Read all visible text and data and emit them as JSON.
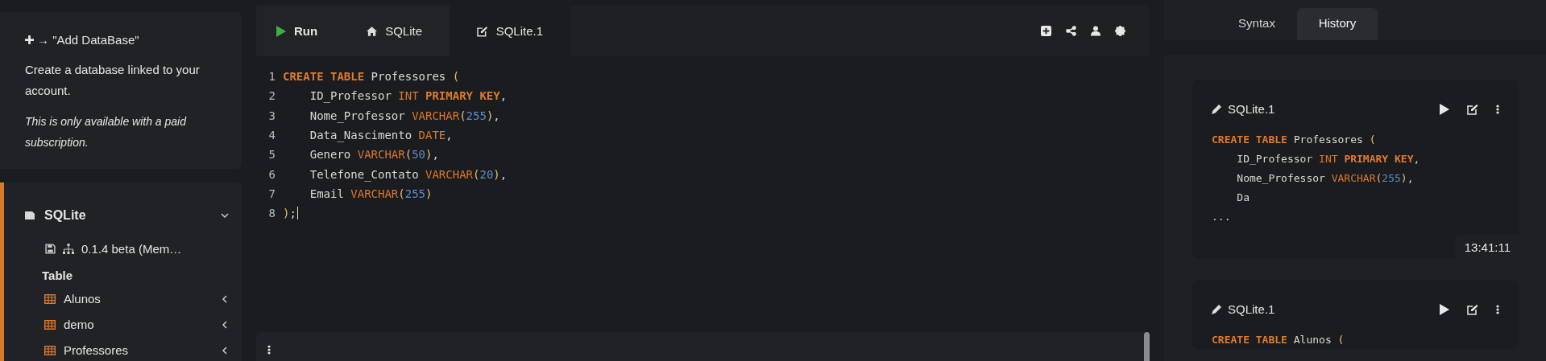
{
  "sidebar": {
    "add_card": {
      "title": "→ \"Add DataBase\"",
      "description": "Create a database linked to your account.",
      "note": "This is only available with a paid subscription."
    },
    "database": {
      "name": "SQLite",
      "expanded": true,
      "version": "0.1.4 beta (Mem…",
      "section": "Table",
      "tables": [
        {
          "name": "Alunos",
          "expanded": false
        },
        {
          "name": "demo",
          "expanded": false
        },
        {
          "name": "Professores",
          "expanded": false
        }
      ]
    }
  },
  "editor": {
    "tabs": [
      {
        "kind": "run",
        "label": "Run",
        "selected": false
      },
      {
        "kind": "home",
        "label": "SQLite",
        "selected": false
      },
      {
        "kind": "edit",
        "label": "SQLite.1",
        "selected": true
      }
    ],
    "lines": [
      {
        "number": "1",
        "cursor": false,
        "tokens": [
          {
            "kind": "keyword",
            "text": "CREATE TABLE"
          },
          {
            "kind": "plain",
            "text": " Professores "
          },
          {
            "kind": "paren",
            "text": "("
          }
        ]
      },
      {
        "number": "2",
        "cursor": false,
        "tokens": [
          {
            "kind": "plain",
            "text": "    ID_Professor "
          },
          {
            "kind": "type",
            "text": "INT "
          },
          {
            "kind": "keyword",
            "text": "PRIMARY KEY"
          },
          {
            "kind": "plain",
            "text": ","
          }
        ]
      },
      {
        "number": "3",
        "cursor": false,
        "tokens": [
          {
            "kind": "plain",
            "text": "    Nome_Professor "
          },
          {
            "kind": "type",
            "text": "VARCHAR"
          },
          {
            "kind": "paren",
            "text": "("
          },
          {
            "kind": "number",
            "text": "255"
          },
          {
            "kind": "paren",
            "text": ")"
          },
          {
            "kind": "plain",
            "text": ","
          }
        ]
      },
      {
        "number": "4",
        "cursor": false,
        "tokens": [
          {
            "kind": "plain",
            "text": "    Data_Nascimento "
          },
          {
            "kind": "type",
            "text": "DATE"
          },
          {
            "kind": "plain",
            "text": ","
          }
        ]
      },
      {
        "number": "5",
        "cursor": false,
        "tokens": [
          {
            "kind": "plain",
            "text": "    Genero "
          },
          {
            "kind": "type",
            "text": "VARCHAR"
          },
          {
            "kind": "paren",
            "text": "("
          },
          {
            "kind": "number",
            "text": "50"
          },
          {
            "kind": "paren",
            "text": ")"
          },
          {
            "kind": "plain",
            "text": ","
          }
        ]
      },
      {
        "number": "6",
        "cursor": false,
        "tokens": [
          {
            "kind": "plain",
            "text": "    Telefone_Contato "
          },
          {
            "kind": "type",
            "text": "VARCHAR"
          },
          {
            "kind": "paren",
            "text": "("
          },
          {
            "kind": "number",
            "text": "20"
          },
          {
            "kind": "paren",
            "text": ")"
          },
          {
            "kind": "plain",
            "text": ","
          }
        ]
      },
      {
        "number": "7",
        "cursor": false,
        "tokens": [
          {
            "kind": "plain",
            "text": "    Email "
          },
          {
            "kind": "type",
            "text": "VARCHAR"
          },
          {
            "kind": "paren",
            "text": "("
          },
          {
            "kind": "number",
            "text": "255"
          },
          {
            "kind": "paren",
            "text": ")"
          }
        ]
      },
      {
        "number": "8",
        "cursor": true,
        "tokens": [
          {
            "kind": "paren",
            "text": ")"
          },
          {
            "kind": "plain",
            "text": ";"
          }
        ]
      }
    ]
  },
  "right_panel": {
    "tabs": [
      {
        "label": "Syntax",
        "selected": false
      },
      {
        "label": "History",
        "selected": true
      }
    ],
    "history": [
      {
        "title": "SQLite.1",
        "time": "13:41:11",
        "lines": [
          [
            {
              "kind": "keyword",
              "text": "CREATE TABLE"
            },
            {
              "kind": "plain",
              "text": " Professores "
            },
            {
              "kind": "paren",
              "text": "("
            }
          ],
          [
            {
              "kind": "plain",
              "text": "    ID_Professor "
            },
            {
              "kind": "type",
              "text": "INT "
            },
            {
              "kind": "keyword",
              "text": "PRIMARY KEY"
            },
            {
              "kind": "plain",
              "text": ","
            }
          ],
          [
            {
              "kind": "plain",
              "text": "    Nome_Professor "
            },
            {
              "kind": "type",
              "text": "VARCHAR"
            },
            {
              "kind": "paren",
              "text": "("
            },
            {
              "kind": "number",
              "text": "255"
            },
            {
              "kind": "paren",
              "text": ")"
            },
            {
              "kind": "plain",
              "text": ","
            }
          ],
          [
            {
              "kind": "plain",
              "text": "    Da"
            }
          ],
          [
            {
              "kind": "plain",
              "text": "..."
            }
          ]
        ]
      },
      {
        "title": "SQLite.1",
        "lines": [
          [
            {
              "kind": "keyword",
              "text": "CREATE TABLE"
            },
            {
              "kind": "plain",
              "text": " Alunos "
            },
            {
              "kind": "paren",
              "text": "("
            }
          ]
        ]
      }
    ]
  }
}
